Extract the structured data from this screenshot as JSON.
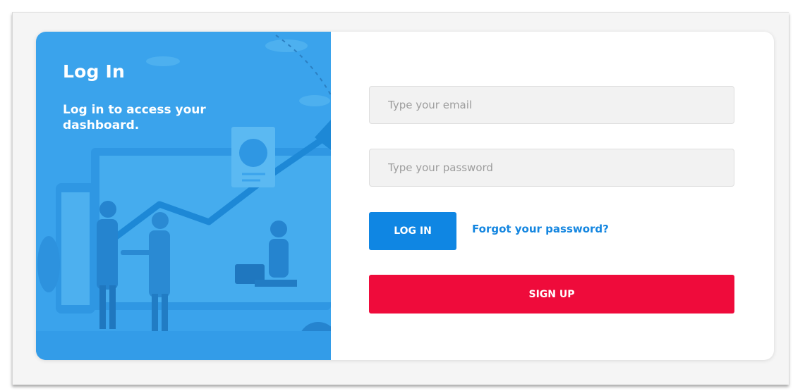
{
  "login_panel": {
    "title": "Log In",
    "subtitle": "Log in to access your dashboard."
  },
  "form": {
    "email_placeholder": "Type your email",
    "email_value": "",
    "password_placeholder": "Type your password",
    "password_value": "",
    "login_label": "LOG IN",
    "forgot_label": "Forgot your password?",
    "signup_label": "SIGN UP"
  },
  "illustration": {
    "icon": "business-handshake-illustration"
  },
  "colors": {
    "panel_blue": "#3aa3ec",
    "login_button": "#0f86e3",
    "link": "#1486e0",
    "signup_button": "#ef0b3b"
  }
}
